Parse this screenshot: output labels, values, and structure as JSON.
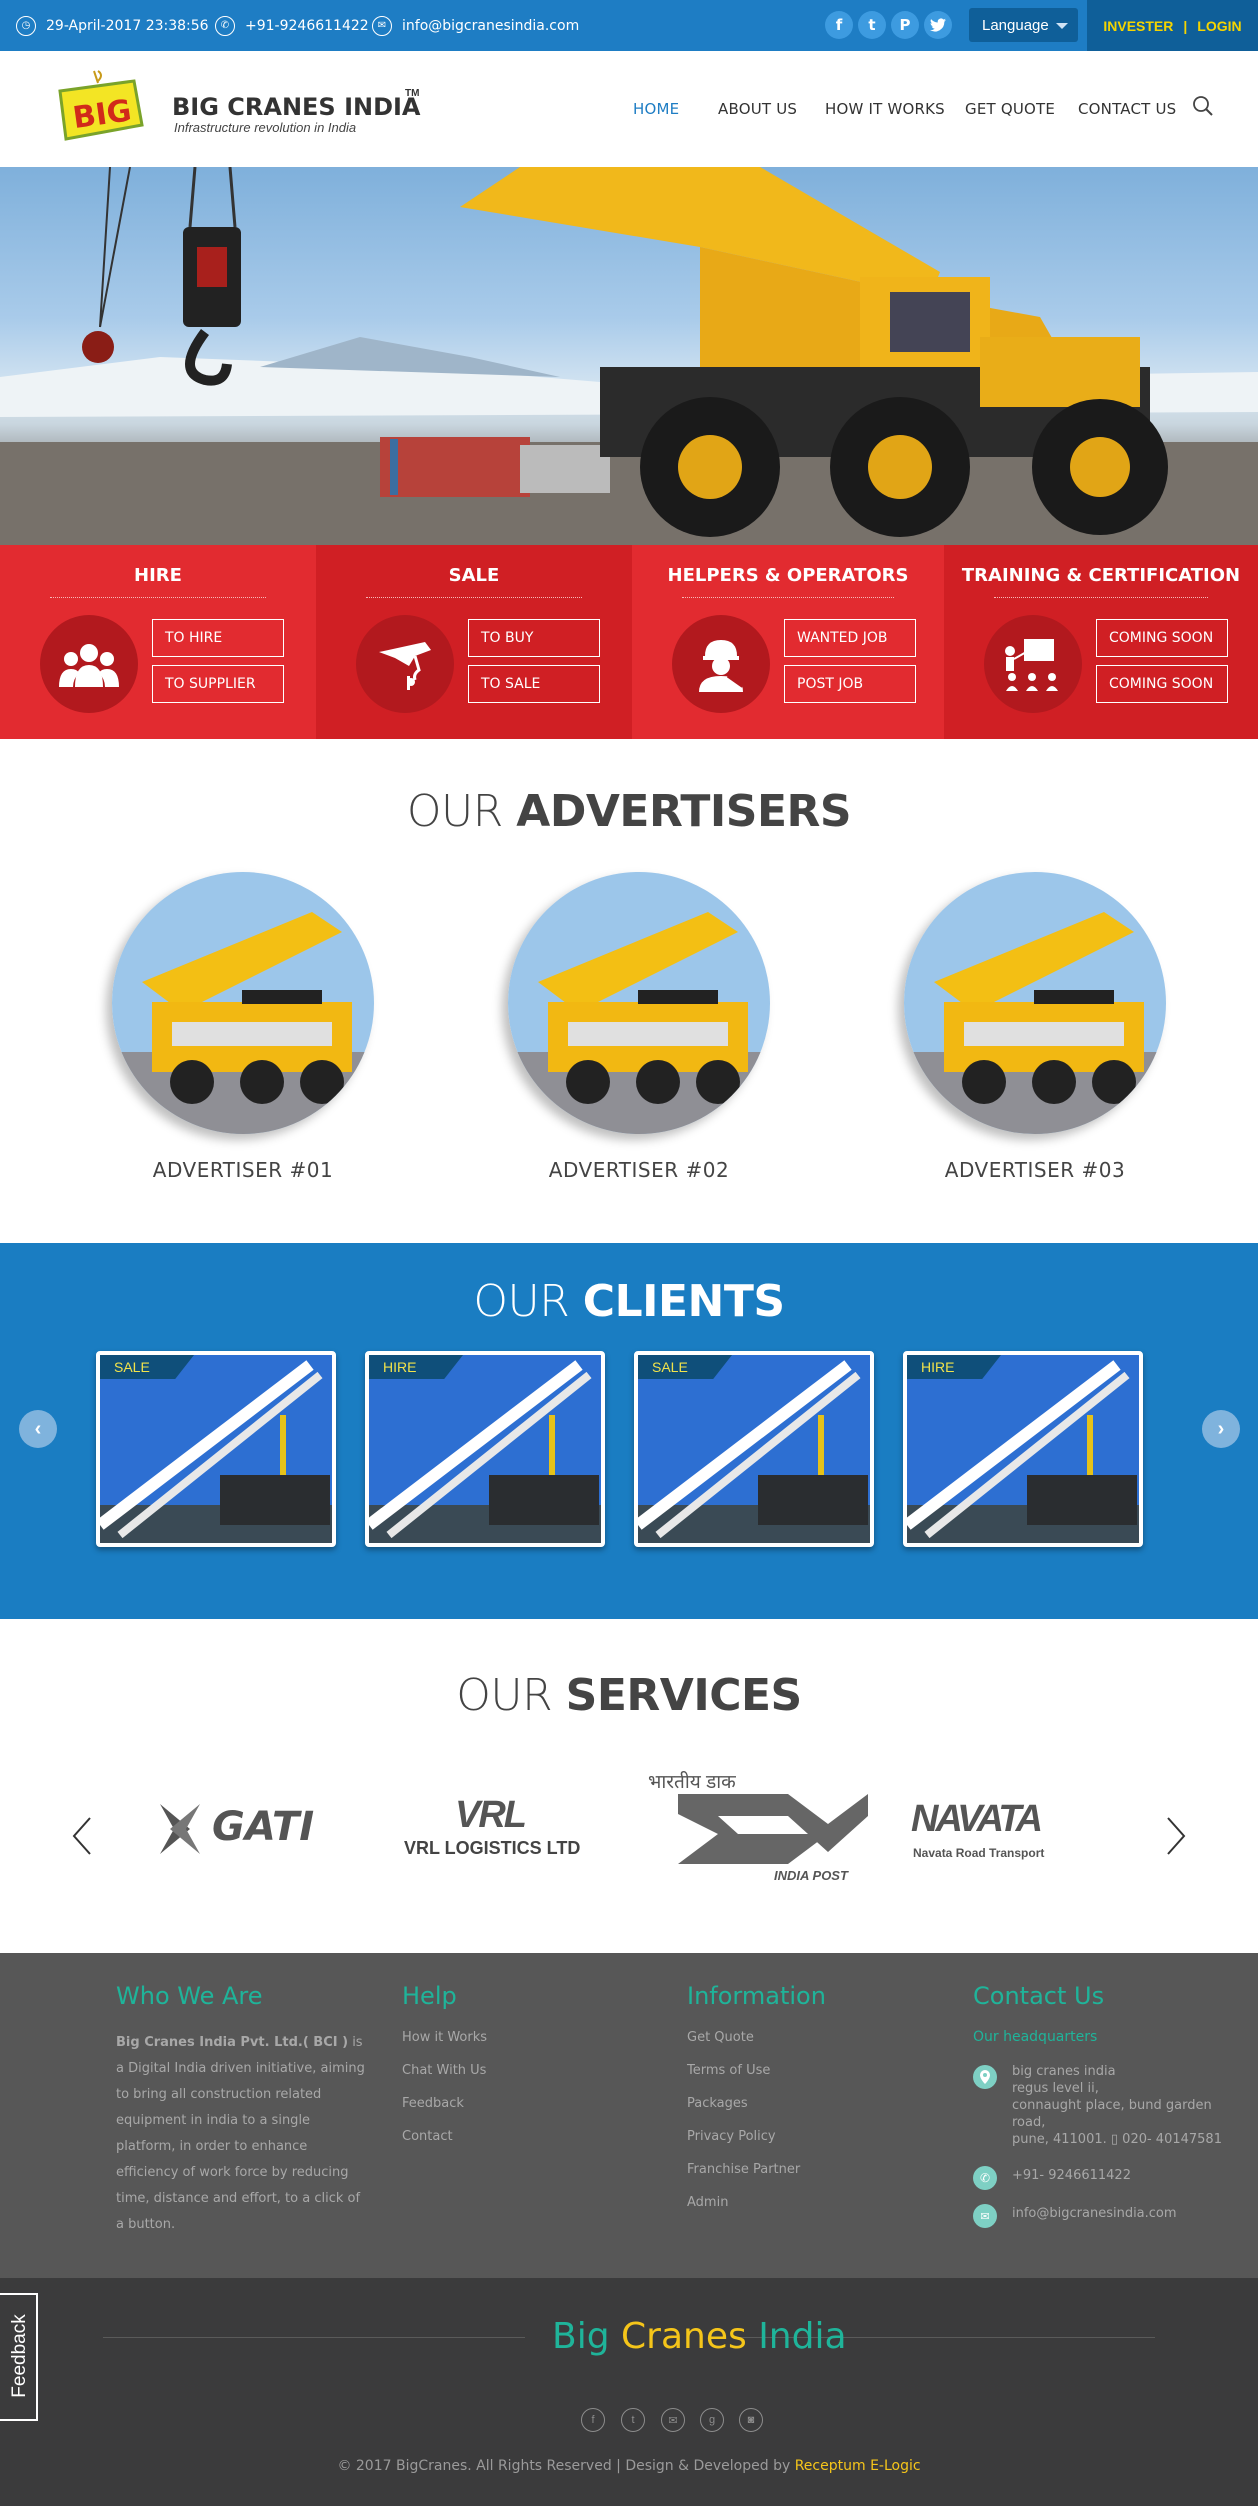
{
  "topbar": {
    "datetime": "29-April-2017 23:38:56",
    "phone": "+91-9246611422",
    "email": "info@bigcranesindia.com",
    "social": [
      "f",
      "t",
      "p",
      "tw"
    ],
    "language": "Language",
    "invester": "INVESTER",
    "separator": "|",
    "login": "LOGIN"
  },
  "brand": {
    "logo_text": "BIG",
    "name": "BIG CRANES INDIA",
    "tm": "TM",
    "tagline": "Infrastructure revolution in India"
  },
  "nav": [
    "HOME",
    "ABOUT US",
    "HOW IT WORKS",
    "GET QUOTE",
    "CONTACT US"
  ],
  "categories": [
    {
      "title": "HIRE",
      "buttons": [
        "TO HIRE",
        "TO SUPPLIER"
      ],
      "icon": "people-icon"
    },
    {
      "title": "SALE",
      "buttons": [
        "TO BUY",
        "TO SALE"
      ],
      "icon": "crane-hook-icon"
    },
    {
      "title": "HELPERS & OPERATORS",
      "buttons": [
        "WANTED JOB",
        "POST JOB"
      ],
      "icon": "worker-icon"
    },
    {
      "title": "TRAINING & CERTIFICATION",
      "buttons": [
        "COMING SOON",
        "COMING SOON"
      ],
      "icon": "training-icon"
    }
  ],
  "advertisers": {
    "title_light": "OUR ",
    "title_bold": "ADVERTISERS",
    "items": [
      "ADVERTISER #01",
      "ADVERTISER #02",
      "ADVERTISER #03"
    ]
  },
  "clients": {
    "title_light": "OUR ",
    "title_bold": "CLIENTS",
    "items": [
      "SALE",
      "HIRE",
      "SALE",
      "HIRE"
    ]
  },
  "services": {
    "title_light": "OUR ",
    "title_bold": "SERVICES",
    "logos": {
      "gati": "GATI",
      "vrl_mark": "VRL",
      "vrl_name": "VRL LOGISTICS LTD",
      "indiapost_hindi": "भारतीय डाक",
      "indiapost": "INDIA POST",
      "navata_mark": "NAVATA",
      "navata": "Navata Road Transport"
    }
  },
  "footer": {
    "who": {
      "heading": "Who We Are",
      "company": "Big Cranes India Pvt. Ltd.( BCI )",
      "text": " is a Digital India driven initiative, aiming to bring all construction related equipment in india to a single platform, in order to enhance efficiency of work force by reducing time, distance and effort, to a click of a button."
    },
    "help": {
      "heading": "Help",
      "links": [
        "How it Works",
        "Chat With Us",
        "Feedback",
        "Contact"
      ]
    },
    "information": {
      "heading": "Information",
      "links": [
        "Get Quote",
        "Terms of Use",
        "Packages",
        "Privacy Policy",
        "Franchise Partner",
        "Admin"
      ]
    },
    "contact": {
      "heading": "Contact Us",
      "sub": "Our headquarters",
      "address_lines": [
        "big cranes india",
        "regus level ii,",
        "connaught place, bund garden",
        "road,",
        "pune, 411001. ▯ 020- 40147581"
      ],
      "phone": "+91- 9246611422",
      "email": "info@bigcranesindia.com"
    }
  },
  "bottom": {
    "brand_big": "Big",
    "brand_cranes": "Cranes",
    "brand_india": "India",
    "copyright": "© 2017 BigCranes. All Rights Reserved | Design & Developed by ",
    "developer": "Receptum E-Logic",
    "feedback": "Feedback"
  },
  "colors": {
    "topbar": "#1e7dc4",
    "band_red": "#e22b30",
    "band_dark_red": "#d01f24",
    "clients_blue": "#1a7dc2",
    "footer": "#575757",
    "footer_bottom": "#3b3b3c",
    "accent_teal": "#1fb49a",
    "accent_yellow": "#f5d400"
  }
}
